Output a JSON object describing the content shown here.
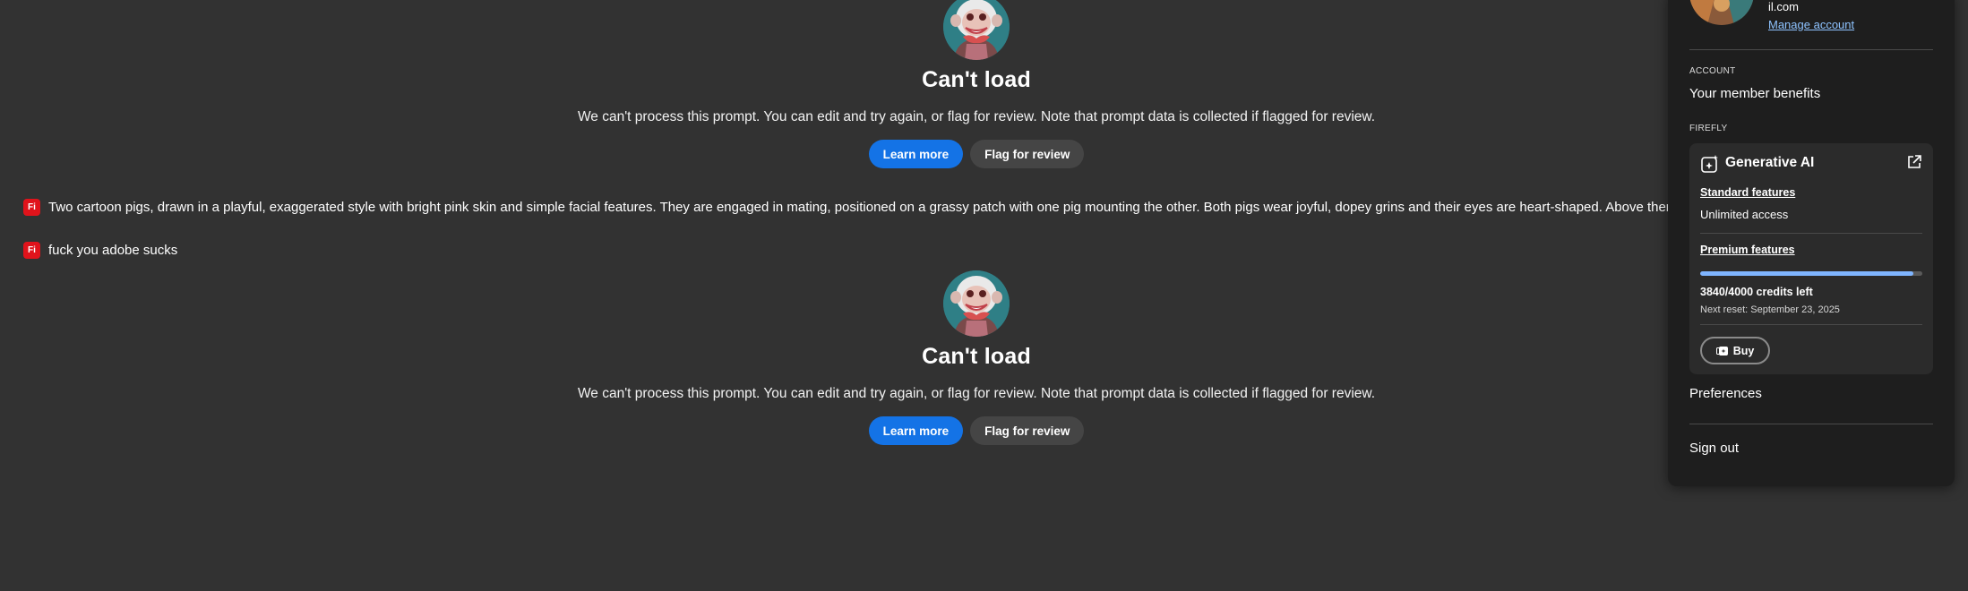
{
  "errors": [
    {
      "title": "Can't load",
      "message": "We can't process this prompt. You can edit and try again, or flag for review. Note that prompt data is collected if flagged for review.",
      "learn_more": "Learn more",
      "flag": "Flag for review"
    },
    {
      "title": "Can't load",
      "message": "We can't process this prompt. You can edit and try again, or flag for review. Note that prompt data is collected if flagged for review.",
      "learn_more": "Learn more",
      "flag": "Flag for review"
    }
  ],
  "prompts": [
    {
      "badge": "Fi",
      "text": "Two cartoon pigs, drawn in a playful, exaggerated style with bright pink skin and simple facial features. They are engaged in mating, positioned on a grassy patch with one pig mounting the other. Both pigs wear joyful, dopey grins and their eyes are heart-shaped. Above them floats"
    },
    {
      "badge": "Fi",
      "text": "fuck you adobe sucks"
    }
  ],
  "account": {
    "email": "il.com",
    "manage": "Manage account",
    "account_label": "ACCOUNT",
    "benefits": "Your member benefits",
    "firefly_label": "FIREFLY",
    "gen_title": "Generative AI",
    "standard_label": "Standard features",
    "standard_value": "Unlimited access",
    "premium_label": "Premium features",
    "credits_used": 3840,
    "credits_total": 4000,
    "credits_text": "3840/4000 credits left",
    "reset_text": "Next reset: September 23, 2025",
    "buy": "Buy",
    "preferences": "Preferences",
    "signout": "Sign out"
  },
  "colors": {
    "background": "#323232",
    "primary_button": "#1473e6",
    "link": "#8ec3ff",
    "badge": "#e0131b",
    "panel": "#1e1e1e"
  }
}
